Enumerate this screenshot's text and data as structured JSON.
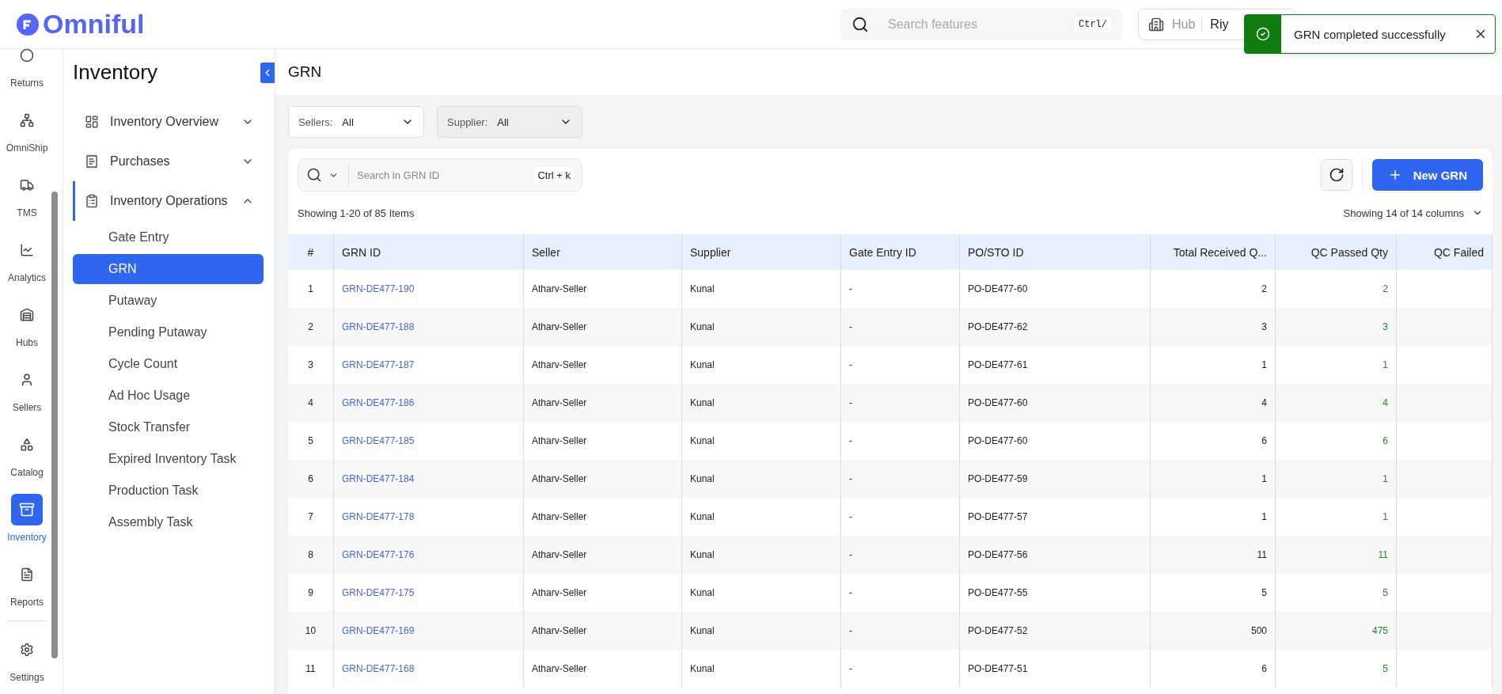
{
  "header": {
    "logo": "Omniful",
    "search": {
      "placeholder": "Search features",
      "shortcut": "Ctrl/"
    },
    "hub": {
      "label": "Hub",
      "value": "Riy"
    }
  },
  "toast": {
    "kind": "success",
    "message": "GRN completed successfully"
  },
  "rail": [
    {
      "label": "Returns",
      "selected": false
    },
    {
      "label": "OmniShip",
      "selected": false
    },
    {
      "label": "TMS",
      "selected": false
    },
    {
      "label": "Analytics",
      "selected": false
    },
    {
      "label": "Hubs",
      "selected": false
    },
    {
      "label": "Sellers",
      "selected": false
    },
    {
      "label": "Catalog",
      "selected": false
    },
    {
      "label": "Inventory",
      "selected": true
    },
    {
      "label": "Reports",
      "selected": false
    }
  ],
  "rail_footer": {
    "label": "Settings"
  },
  "sidebar": {
    "title": "Inventory",
    "groups": [
      {
        "label": "Inventory Overview",
        "selected": false,
        "expanded": false
      },
      {
        "label": "Purchases",
        "selected": false,
        "expanded": false
      },
      {
        "label": "Inventory Operations",
        "selected": true,
        "expanded": true,
        "children": [
          {
            "label": "Gate Entry",
            "selected": false
          },
          {
            "label": "GRN",
            "selected": true
          },
          {
            "label": "Putaway",
            "selected": false
          },
          {
            "label": "Pending Putaway",
            "selected": false
          },
          {
            "label": "Cycle Count",
            "selected": false
          },
          {
            "label": "Ad Hoc Usage",
            "selected": false
          },
          {
            "label": "Stock Transfer",
            "selected": false
          },
          {
            "label": "Expired Inventory Task",
            "selected": false
          },
          {
            "label": "Production Task",
            "selected": false
          },
          {
            "label": "Assembly Task",
            "selected": false
          }
        ]
      }
    ]
  },
  "page_title": "GRN",
  "filters": [
    {
      "label": "Sellers:",
      "value": "All",
      "disabled": false
    },
    {
      "label": "Supplier:",
      "value": "All",
      "disabled": true
    }
  ],
  "table_search": {
    "placeholder": "Search in GRN ID",
    "shortcut": "Ctrl + k"
  },
  "new_button": "New GRN",
  "items_summary": "Showing 1-20 of 85 Items",
  "columns_summary": "Showing 14 of 14 columns",
  "table": {
    "columns": [
      "#",
      "GRN ID",
      "Seller",
      "Supplier",
      "Gate Entry ID",
      "PO/STO ID",
      "Total Received Q...",
      "QC Passed Qty",
      "QC Failed"
    ],
    "rows": [
      [
        "1",
        "GRN-DE477-190",
        "Atharv-Seller",
        "Kunal",
        "-",
        "PO-DE477-60",
        "2",
        "2"
      ],
      [
        "2",
        "GRN-DE477-188",
        "Atharv-Seller",
        "Kunal",
        "-",
        "PO-DE477-62",
        "3",
        "3"
      ],
      [
        "3",
        "GRN-DE477-187",
        "Atharv-Seller",
        "Kunal",
        "-",
        "PO-DE477-61",
        "1",
        "1"
      ],
      [
        "4",
        "GRN-DE477-186",
        "Atharv-Seller",
        "Kunal",
        "-",
        "PO-DE477-60",
        "4",
        "4"
      ],
      [
        "5",
        "GRN-DE477-185",
        "Atharv-Seller",
        "Kunal",
        "-",
        "PO-DE477-60",
        "6",
        "6"
      ],
      [
        "6",
        "GRN-DE477-184",
        "Atharv-Seller",
        "Kunal",
        "-",
        "PO-DE477-59",
        "1",
        "1"
      ],
      [
        "7",
        "GRN-DE477-178",
        "Atharv-Seller",
        "Kunal",
        "-",
        "PO-DE477-57",
        "1",
        "1"
      ],
      [
        "8",
        "GRN-DE477-176",
        "Atharv-Seller",
        "Kunal",
        "-",
        "PO-DE477-56",
        "11",
        "11"
      ],
      [
        "9",
        "GRN-DE477-175",
        "Atharv-Seller",
        "Kunal",
        "-",
        "PO-DE477-55",
        "5",
        "5"
      ],
      [
        "10",
        "GRN-DE477-169",
        "Atharv-Seller",
        "Kunal",
        "-",
        "PO-DE477-52",
        "500",
        "475"
      ],
      [
        "11",
        "GRN-DE477-168",
        "Atharv-Seller",
        "Kunal",
        "-",
        "PO-DE477-51",
        "6",
        "5"
      ]
    ]
  }
}
